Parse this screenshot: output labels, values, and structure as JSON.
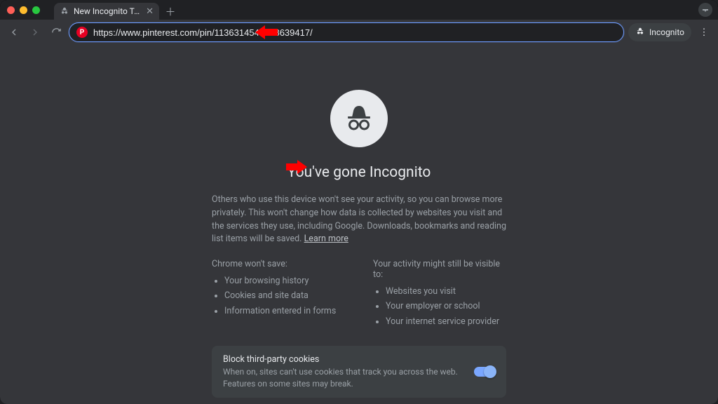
{
  "tab": {
    "title": "New Incognito Tab",
    "favicon": "incognito-icon"
  },
  "toolbar": {
    "url": "https://www.pinterest.com/pin/1136314549728639417/",
    "incognito_chip_label": "Incognito"
  },
  "page": {
    "headline": "You've gone Incognito",
    "body": "Others who use this device won't see your activity, so you can browse more privately. This won't change how data is collected by websites you visit and the services they use, including Google. Downloads, bookmarks and reading list items will be saved.",
    "learn_more": "Learn more",
    "col1_head": "Chrome won't save:",
    "col1_items": [
      "Your browsing history",
      "Cookies and site data",
      "Information entered in forms"
    ],
    "col2_head": "Your activity might still be visible to:",
    "col2_items": [
      "Websites you visit",
      "Your employer or school",
      "Your internet service provider"
    ],
    "cookie_title": "Block third-party cookies",
    "cookie_desc": "When on, sites can't use cookies that track you across the web. Features on some sites may break.",
    "cookie_toggle_on": true
  },
  "colors": {
    "accent": "#8ab4f8",
    "pinterest_red": "#e60023",
    "annotation_red": "#ff0000"
  }
}
